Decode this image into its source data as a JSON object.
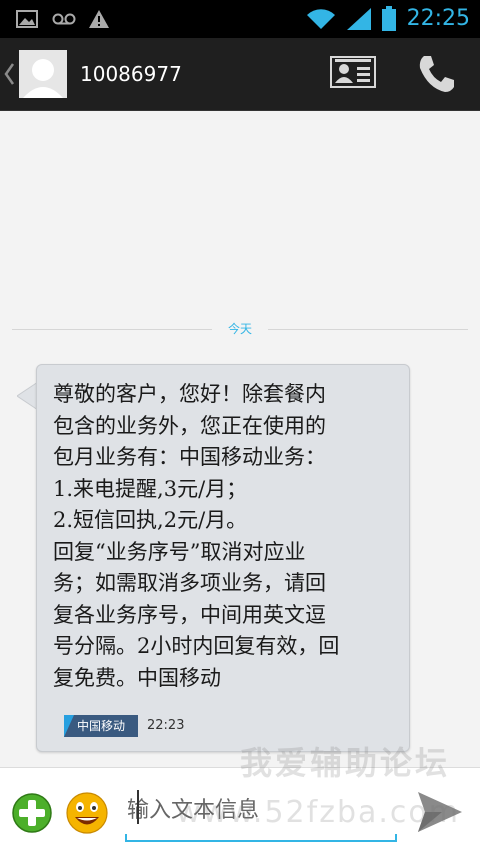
{
  "status_bar": {
    "time": "22:25",
    "icons": [
      "image-notification-icon",
      "voicemail-icon",
      "warning-icon",
      "wifi-icon",
      "signal-icon",
      "battery-icon"
    ],
    "accent_color": "#33b5e5"
  },
  "header": {
    "contact_number": "10086977",
    "icons": [
      "back-caret-icon",
      "avatar-icon",
      "contact-card-icon",
      "phone-icon"
    ]
  },
  "conversation": {
    "date_label": "今天",
    "messages": [
      {
        "text": "尊敬的客户，您好！除套餐内\n包含的业务外，您正在使用的\n包月业务有：中国移动业务：\n1.来电提醒,3元/月；\n2.短信回执,2元/月。\n回复“业务序号”取消对应业\n务；如需取消多项业务，请回\n复各业务序号，中间用英文逗\n号分隔。2小时内回复有效，回\n复免费。中国移动",
        "sender_badge": "中国移动",
        "time": "22:23"
      }
    ]
  },
  "watermark": {
    "title": "我爱辅助论坛",
    "url": "www.52fzba.com"
  },
  "compose": {
    "placeholder": "输入文本信息",
    "icons": [
      "add-attachment-icon",
      "emoji-icon",
      "send-icon"
    ]
  }
}
